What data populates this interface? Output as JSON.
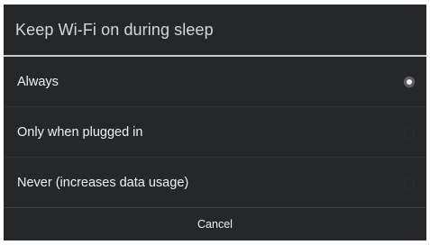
{
  "dialog": {
    "title": "Keep Wi-Fi on during sleep",
    "options": [
      {
        "label": "Always",
        "selected": true
      },
      {
        "label": "Only when plugged in",
        "selected": false
      },
      {
        "label": "Never (increases data usage)",
        "selected": false
      }
    ],
    "cancel_label": "Cancel"
  },
  "colors": {
    "dialog_background": "#262729",
    "title_divider": "#c9cbcd",
    "text": "#f0f1f2"
  }
}
